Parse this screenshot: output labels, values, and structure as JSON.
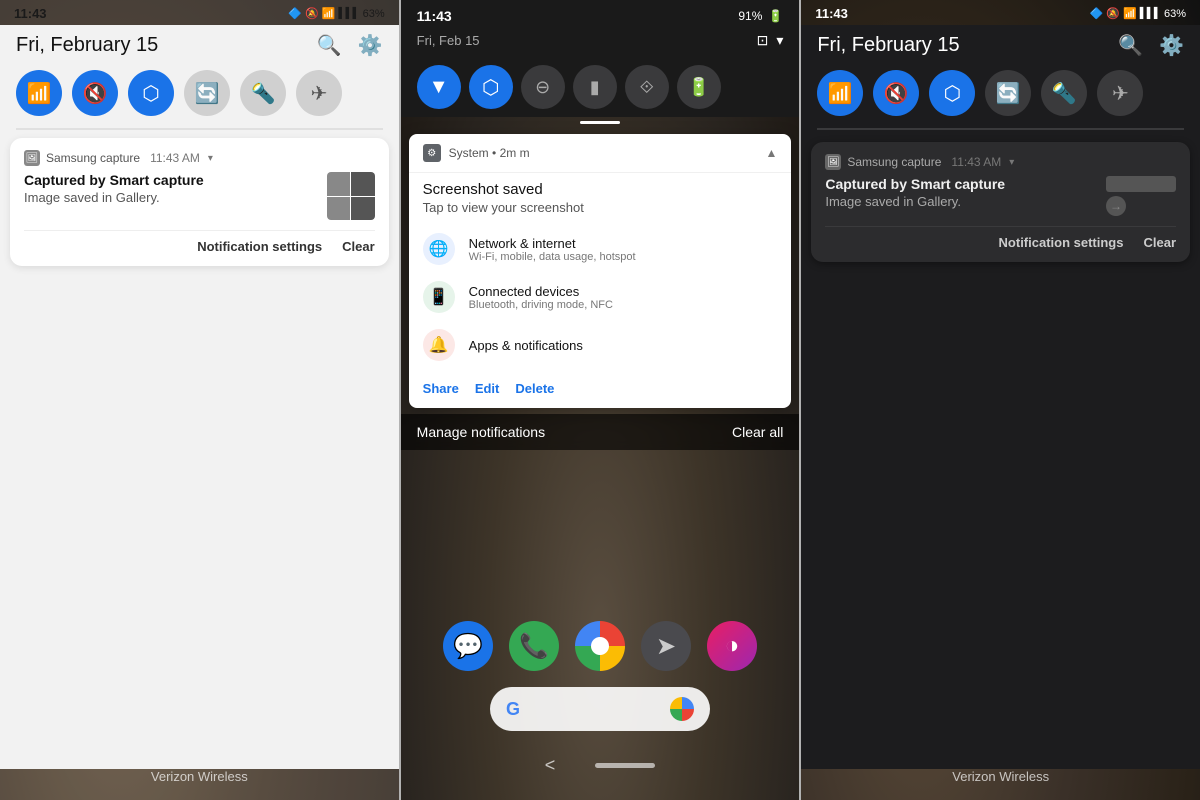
{
  "panels": {
    "left": {
      "theme": "light",
      "status": {
        "time": "11:43",
        "date": "Fri, February 15",
        "icons": [
          "bluetooth",
          "volume-off",
          "wifi",
          "signal",
          "battery"
        ],
        "battery_pct": "63%"
      },
      "quick_tiles": [
        {
          "id": "wifi",
          "label": "WiFi",
          "active": true,
          "icon": "📶"
        },
        {
          "id": "mute",
          "label": "Mute",
          "active": true,
          "icon": "🔇"
        },
        {
          "id": "bluetooth",
          "label": "Bluetooth",
          "active": true,
          "icon": "🔵"
        },
        {
          "id": "rotate",
          "label": "Rotate",
          "active": false,
          "icon": "⟳"
        },
        {
          "id": "flashlight",
          "label": "Flashlight",
          "active": false,
          "icon": "🔦"
        },
        {
          "id": "airplane",
          "label": "Airplane",
          "active": false,
          "icon": "✈"
        }
      ],
      "notification": {
        "app": "Samsung capture",
        "time": "11:43 AM",
        "title": "Captured by Smart capture",
        "body": "Image saved in Gallery.",
        "actions": [
          "Notification settings",
          "Clear"
        ]
      },
      "carrier": "Verizon Wireless"
    },
    "center": {
      "theme": "dark",
      "status": {
        "time": "11:43",
        "date": "Fri, Feb 15",
        "battery_pct": "91%"
      },
      "quick_tiles": [
        {
          "id": "wifi",
          "active": true
        },
        {
          "id": "bluetooth",
          "active": true
        },
        {
          "id": "dnd",
          "active": false
        },
        {
          "id": "flashlight",
          "active": false
        },
        {
          "id": "rotate",
          "active": false
        },
        {
          "id": "battery",
          "active": false
        }
      ],
      "notification": {
        "app": "System",
        "time_ago": "2m",
        "title": "Screenshot saved",
        "subtitle": "Tap to view your screenshot",
        "settings_items": [
          {
            "icon": "🌐",
            "icon_type": "network",
            "title": "Network & internet",
            "subtitle": "Wi-Fi, mobile, data usage, hotspot"
          },
          {
            "icon": "📱",
            "icon_type": "devices",
            "title": "Connected devices",
            "subtitle": "Bluetooth, driving mode, NFC"
          },
          {
            "icon": "🔔",
            "icon_type": "apps",
            "title": "Apps & notifications",
            "subtitle": ""
          }
        ],
        "actions": [
          "Share",
          "Edit",
          "Delete"
        ]
      },
      "manage_bar": {
        "left": "Manage notifications",
        "right": "Clear all"
      },
      "home_apps": [
        "messages",
        "phone",
        "chrome",
        "send",
        "pixel"
      ],
      "nav": {
        "back": "<",
        "home_pill": ""
      }
    },
    "right": {
      "theme": "dark",
      "status": {
        "time": "11:43",
        "date": "Fri, February 15",
        "icons": [
          "bluetooth",
          "volume-off",
          "wifi",
          "signal",
          "battery"
        ],
        "battery_pct": "63%"
      },
      "quick_tiles": [
        {
          "id": "wifi",
          "active": true
        },
        {
          "id": "mute",
          "active": true
        },
        {
          "id": "bluetooth",
          "active": true
        },
        {
          "id": "rotate",
          "active": false
        },
        {
          "id": "flashlight",
          "active": false
        },
        {
          "id": "airplane",
          "active": false
        }
      ],
      "notification": {
        "app": "Samsung capture",
        "time": "11:43 AM",
        "title": "Captured by Smart capture",
        "body": "Image saved in Gallery.",
        "actions": [
          "Notification settings",
          "Clear"
        ]
      },
      "carrier": "Verizon Wireless"
    }
  }
}
